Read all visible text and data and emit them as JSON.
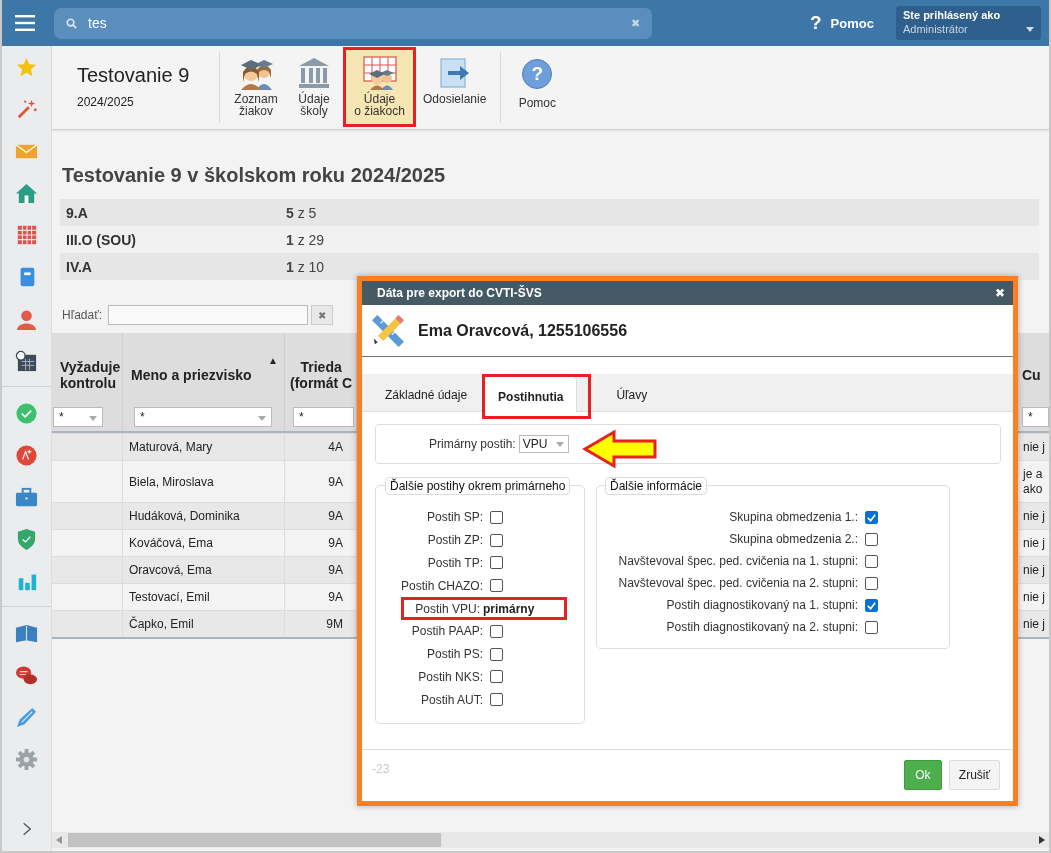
{
  "topbar": {
    "search": {
      "value": "tes",
      "clear": "✖"
    },
    "help": {
      "glyph": "?",
      "label": "Pomoc"
    },
    "user": {
      "caption": "Ste prihlásený ako",
      "name": "Administrátor"
    }
  },
  "toolbar": {
    "title": "Testovanie 9",
    "subtitle": "2024/2025",
    "buttons": [
      {
        "label": "Zoznam\nžiakov",
        "selected": false,
        "highlighted": false,
        "separated": false
      },
      {
        "label": "Údaje\nškoly",
        "selected": false,
        "highlighted": false,
        "separated": false
      },
      {
        "label": "Údaje\no žiakoch",
        "selected": true,
        "highlighted": true,
        "separated": false
      },
      {
        "label": "Odosielanie",
        "selected": false,
        "highlighted": false,
        "separated": false
      },
      {
        "label": "Pomoc",
        "glyph": "?",
        "selected": false,
        "highlighted": false,
        "separated": true
      }
    ]
  },
  "page": {
    "heading": "Testovanie 9 v školskom roku 2024/2025",
    "classes": [
      {
        "name": "9.A",
        "count": "**5** z 5"
      },
      {
        "name": "III.O (SOU)",
        "count": "**1** z 29"
      },
      {
        "name": "IV.A",
        "count": "**1** z 10"
      }
    ],
    "search": {
      "label": "Hľadať:",
      "clear": "✖"
    }
  },
  "table": {
    "columns": [
      {
        "label": "Vyžaduje\nkontrolu",
        "filter": "*"
      },
      {
        "label": "Meno a priezvisko",
        "filter": "*",
        "sort_mark": "▲"
      },
      {
        "label": "Trieda\n(formát C",
        "filter": "*"
      },
      {
        "label": "Cu",
        "filter": "*"
      }
    ],
    "rows": [
      {
        "name": "Maturová, Mary",
        "class": "4A",
        "column_4": "nie j"
      },
      {
        "name": "Biela, Miroslava",
        "class": "9A",
        "column_4": "je a\nako"
      },
      {
        "name": "Hudáková, Dominika",
        "class": "9A",
        "column_4": "nie j"
      },
      {
        "name": "Kováčová, Ema",
        "class": "9A",
        "column_4": "nie j"
      },
      {
        "name": "Oravcová, Ema",
        "class": "9A",
        "column_4": "nie j"
      },
      {
        "name": "Testovací, Emil",
        "class": "9A",
        "column_4": "nie j"
      },
      {
        "name": "Čapko, Emil",
        "class": "9M",
        "column_4": "nie j"
      }
    ]
  },
  "dialog": {
    "title": "Dáta pre export do CVTI-ŠVS",
    "close": "✖",
    "heading": "Ema Oravcová, 1255106556",
    "tabs": [
      {
        "label": "Základné údaje",
        "selected": false,
        "highlighted": false
      },
      {
        "label": "Postihnutia",
        "selected": true,
        "highlighted": true
      },
      {
        "label": "Úľavy",
        "selected": false,
        "highlighted": false
      }
    ],
    "primary": {
      "label": "Primárny postih:",
      "value": "VPU"
    },
    "groups": [
      {
        "legend": "Ďalšie postihy okrem primárneho",
        "items": [
          {
            "kind": "checkbox",
            "label": "Postih SP:",
            "checked": false
          },
          {
            "kind": "checkbox",
            "label": "Postih ZP:",
            "checked": false
          },
          {
            "kind": "checkbox",
            "label": "Postih TP:",
            "checked": false
          },
          {
            "kind": "checkbox",
            "label": "Postih CHAZO:",
            "checked": false
          },
          {
            "kind": "text",
            "label": "Postih VPU:",
            "value": "primárny",
            "highlighted": true
          },
          {
            "kind": "checkbox",
            "label": "Postih PAAP:",
            "checked": false
          },
          {
            "kind": "checkbox",
            "label": "Postih PS:",
            "checked": false
          },
          {
            "kind": "checkbox",
            "label": "Postih NKS:",
            "checked": false
          },
          {
            "kind": "checkbox",
            "label": "Postih AUT:",
            "checked": false
          }
        ]
      },
      {
        "legend": "Ďalšie informácie",
        "items": [
          {
            "kind": "checkbox",
            "label": "Skupina obmedzenia 1.:",
            "checked": true
          },
          {
            "kind": "checkbox",
            "label": "Skupina obmedzenia 2.:",
            "checked": false
          },
          {
            "kind": "checkbox",
            "label": "Navštevoval špec. ped. cvičenia na 1. stupni:",
            "checked": false
          },
          {
            "kind": "checkbox",
            "label": "Navštevoval špec. ped. cvičenia na 2. stupni:",
            "checked": false
          },
          {
            "kind": "checkbox",
            "label": "Postih diagnostikovaný na 1. stupni:",
            "checked": true
          },
          {
            "kind": "checkbox",
            "label": "Postih diagnostikovaný na 2. stupni:",
            "checked": false
          }
        ]
      }
    ],
    "note": "-23",
    "buttons": [
      {
        "label": "Ok",
        "kind": "primary"
      },
      {
        "label": "Zrušiť",
        "kind": "default"
      }
    ]
  }
}
